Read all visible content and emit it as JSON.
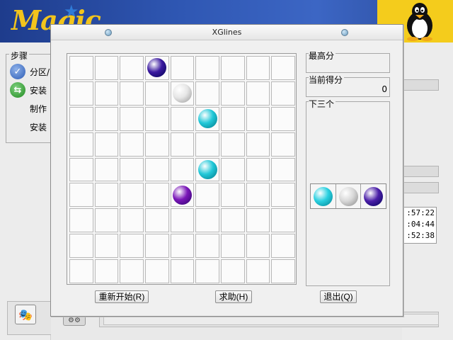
{
  "installer": {
    "logo_text": "Magic",
    "steps_title": "步骤",
    "steps": [
      {
        "label": "分区/",
        "icon": "check-circle-icon"
      },
      {
        "label": "安装",
        "icon": "arrows-circle-icon"
      },
      {
        "label": "制作",
        "icon": ""
      },
      {
        "label": "安装",
        "icon": ""
      }
    ],
    "times": [
      ":57:22",
      ":04:44",
      ":52:38"
    ]
  },
  "window": {
    "title": "XGlines",
    "best_label": "最高分",
    "best_value": "",
    "current_label": "当前得分",
    "current_value": "0",
    "next_label": "下三个",
    "next_balls": [
      "#2ad0e0",
      "#d8d8d8",
      "#4b1fa8"
    ],
    "buttons": {
      "restart": "重新开始(R)",
      "help": "求助(H)",
      "quit": "退出(Q)"
    }
  },
  "colors": {
    "dark_purple": "#3b1aa0",
    "purple": "#7a17b8",
    "cyan": "#22c8d8",
    "white": "#e6e6e6",
    "window_bg": "#f0f0f0",
    "header_blue": "#2a4a9a",
    "header_yellow": "#f4cc1c"
  },
  "board": {
    "rows": 9,
    "cols": 9,
    "balls": [
      {
        "row": 0,
        "col": 3,
        "color": "#3b1aa0"
      },
      {
        "row": 1,
        "col": 4,
        "color": "#e6e6e6"
      },
      {
        "row": 2,
        "col": 5,
        "color": "#22c8d8"
      },
      {
        "row": 4,
        "col": 5,
        "color": "#22c8d8"
      },
      {
        "row": 5,
        "col": 4,
        "color": "#7a17b8"
      }
    ]
  }
}
